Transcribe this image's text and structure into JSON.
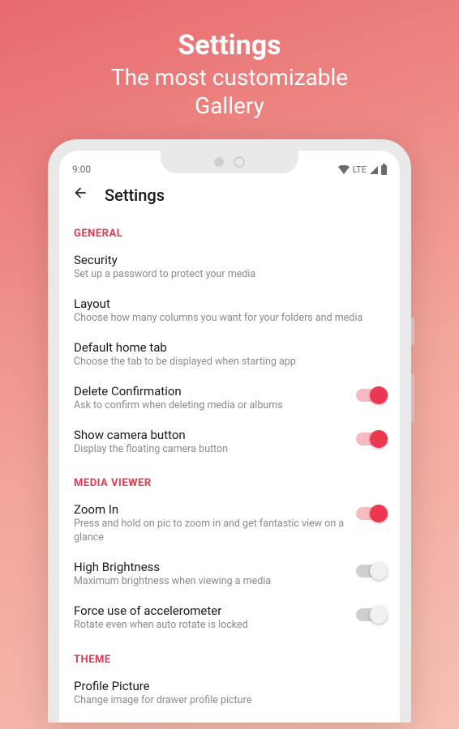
{
  "colors": {
    "accent": "#eb3850"
  },
  "hero": {
    "title": "Settings",
    "subtitle_l1": "The most customizable",
    "subtitle_l2": "Gallery"
  },
  "status": {
    "time": "9:00",
    "network": "LTE"
  },
  "appbar": {
    "title": "Settings"
  },
  "sections": {
    "general": {
      "header": "GENERAL",
      "security": {
        "title": "Security",
        "sub": "Set up a password to protect your media"
      },
      "layout": {
        "title": "Layout",
        "sub": "Choose how many columns you want for your folders and media"
      },
      "home_tab": {
        "title": "Default home tab",
        "sub": "Choose the tab to be displayed when starting app"
      },
      "delete_confirm": {
        "title": "Delete Confirmation",
        "sub": "Ask to confirm when deleting media or albums",
        "on": true
      },
      "camera_btn": {
        "title": "Show camera button",
        "sub": "Display the floating camera button",
        "on": true
      }
    },
    "viewer": {
      "header": "MEDIA VIEWER",
      "zoom": {
        "title": "Zoom In",
        "sub": "Press and hold on pic to zoom in and get fantastic view on a glance",
        "on": true
      },
      "brightness": {
        "title": "High Brightness",
        "sub": "Maximum brightness when viewing a media",
        "on": false
      },
      "accel": {
        "title": "Force use of accelerometer",
        "sub": "Rotate even when auto rotate is locked",
        "on": false
      }
    },
    "theme": {
      "header": "THEME",
      "profile": {
        "title": "Profile Picture",
        "sub": "Change image for drawer profile picture"
      }
    }
  }
}
